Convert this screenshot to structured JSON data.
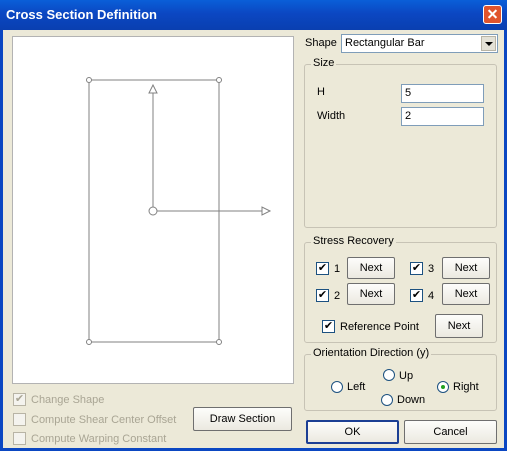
{
  "window": {
    "title": "Cross Section Definition"
  },
  "shape": {
    "label": "Shape",
    "value": "Rectangular Bar"
  },
  "size": {
    "title": "Size",
    "h_label": "H",
    "h_value": "5",
    "width_label": "Width",
    "width_value": "2"
  },
  "stress_recovery": {
    "title": "Stress Recovery",
    "points": [
      {
        "label": "1",
        "checked": true,
        "next": "Next"
      },
      {
        "label": "3",
        "checked": true,
        "next": "Next"
      },
      {
        "label": "2",
        "checked": true,
        "next": "Next"
      },
      {
        "label": "4",
        "checked": true,
        "next": "Next"
      }
    ],
    "reference_point_label": "Reference Point",
    "reference_next": "Next",
    "check_mark": "✔"
  },
  "orientation": {
    "title": "Orientation Direction (y)",
    "left": "Left",
    "up": "Up",
    "down": "Down",
    "right": "Right",
    "selected": "Right"
  },
  "options": {
    "change_shape": "Change Shape",
    "shear_center": "Compute Shear Center Offset",
    "warping": "Compute Warping Constant"
  },
  "buttons": {
    "draw_section": "Draw Section",
    "ok": "OK",
    "cancel": "Cancel"
  }
}
